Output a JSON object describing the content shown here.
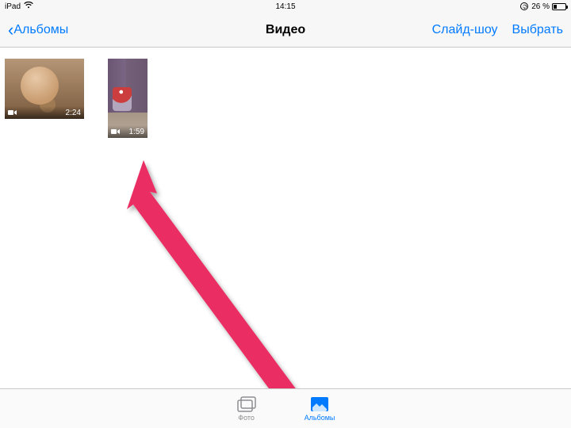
{
  "status": {
    "device": "iPad",
    "time": "14:15",
    "battery_pct": "26 %"
  },
  "nav": {
    "back_label": "Альбомы",
    "title": "Видео",
    "slideshow": "Слайд-шоу",
    "select": "Выбрать"
  },
  "videos": [
    {
      "duration": "2:24"
    },
    {
      "duration": "1:59"
    }
  ],
  "tabs": {
    "photos": "Фото",
    "albums": "Альбомы"
  }
}
